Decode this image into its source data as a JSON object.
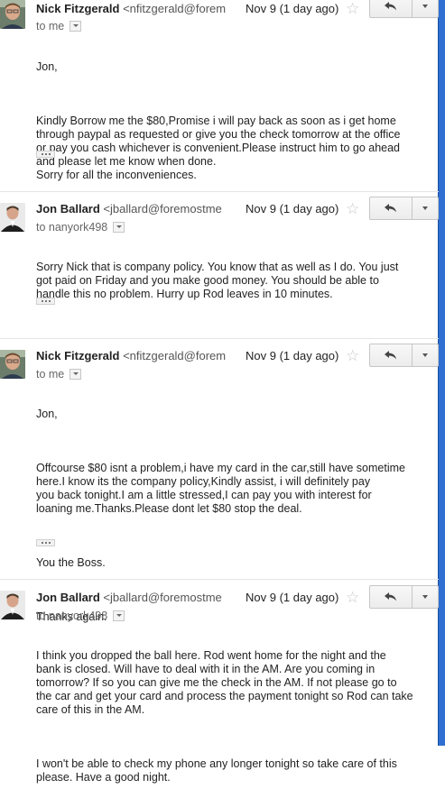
{
  "messages": [
    {
      "sender_name": "Nick Fitzgerald",
      "sender_email": "<nfitzgerald@forem",
      "date": "Nov 9 (1 day ago)",
      "recipient": "to me",
      "paragraphs": [
        "Jon,",
        "Kindly Borrow me the $80,Promise i will pay back as soon as i get home\nthrough paypal as requested or give you the check tomorrow at the office\nor pay you cash whichever is convenient.Please instruct him to go ahead\nand please let me know when done.\nSorry for all the inconveniences."
      ]
    },
    {
      "sender_name": "Jon Ballard",
      "sender_email": "<jballard@foremostme",
      "date": "Nov 9 (1 day ago)",
      "recipient": "to nanyork498",
      "paragraphs": [
        "Sorry Nick that is company policy.  You know that as well as I do.  You just\ngot paid on Friday and you make good money.   You should be able to\nhandle this no problem.  Hurry up Rod leaves in 10 minutes."
      ]
    },
    {
      "sender_name": "Nick Fitzgerald",
      "sender_email": "<nfitzgerald@forem",
      "date": "Nov 9 (1 day ago)",
      "recipient": "to me",
      "paragraphs": [
        "Jon,",
        "Offcourse $80 isnt a problem,i have my card in the car,still have sometime\nhere.I know its the company policy,Kindly assist, i will definitely pay\nyou back tonight.I am a little stressed,I can pay you with interest for\nloaning me.Thanks.Please dont let $80 stop the deal.",
        "You the Boss.",
        "Thanks again."
      ]
    },
    {
      "sender_name": "Jon Ballard",
      "sender_email": "<jballard@foremostme",
      "date": "Nov 9 (1 day ago)",
      "recipient": "to nanyork498",
      "paragraphs": [
        "I think you dropped the ball here.  Rod went home for the night and the\nbank is closed.  Will have to deal with it in the AM.  Are you coming in\ntomorrow?  If so you can give me the check in the AM.  If not please go to\nthe car and get your card and process the payment tonight so Rod can take\ncare of this in the AM.",
        "I won't be able to check my phone any longer tonight so take care of this\nplease.  Have a good night."
      ]
    }
  ],
  "colors": {
    "accent_bar": "#2f6fd1",
    "star": "#c6c6c6"
  },
  "icons": {
    "reply": "reply-arrow-icon",
    "more": "chevron-down-icon",
    "star": "star-icon"
  }
}
